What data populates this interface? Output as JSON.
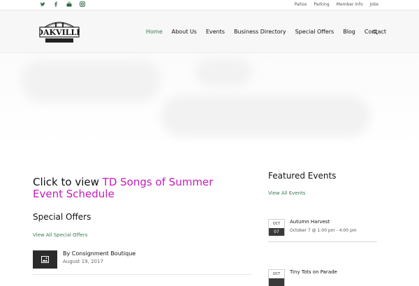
{
  "topbar": {
    "social": [
      {
        "icon": "twitter-icon",
        "glyph": "🐦︎"
      },
      {
        "icon": "facebook-icon",
        "glyph": "f"
      },
      {
        "icon": "youtube-icon",
        "glyph": "▶"
      },
      {
        "icon": "instagram-icon",
        "glyph": "◘"
      }
    ],
    "links": [
      "Patios",
      "Parking",
      "Member Info",
      "Jobs"
    ]
  },
  "header": {
    "logo_text": "OAKVILLE",
    "nav": [
      "Home",
      "About Us",
      "Events",
      "Business Directory",
      "Special Offers",
      "Blog",
      "Contact"
    ],
    "active": "Home"
  },
  "main": {
    "cta_prefix": "Click to view ",
    "cta_link": "TD Songs of Summer Event Schedule",
    "special_heading": "Special Offers",
    "view_offers": "View All Special Offers",
    "offer": {
      "title": "By Consignment Boutique",
      "date": "August 19, 2017"
    }
  },
  "sidebar": {
    "heading": "Featured Events",
    "view_events": "View All Events",
    "events": [
      {
        "month": "OCT",
        "day": "07",
        "title": "Autumn Harvest",
        "time": "October 7 @ 1:00 pm - 4:00 pm"
      },
      {
        "month": "OCT",
        "day": "",
        "title": "Tiny Tots on Parade",
        "time": ""
      }
    ]
  },
  "colors": {
    "accent_green": "#3a7a4e",
    "accent_magenta": "#c41bb9"
  }
}
